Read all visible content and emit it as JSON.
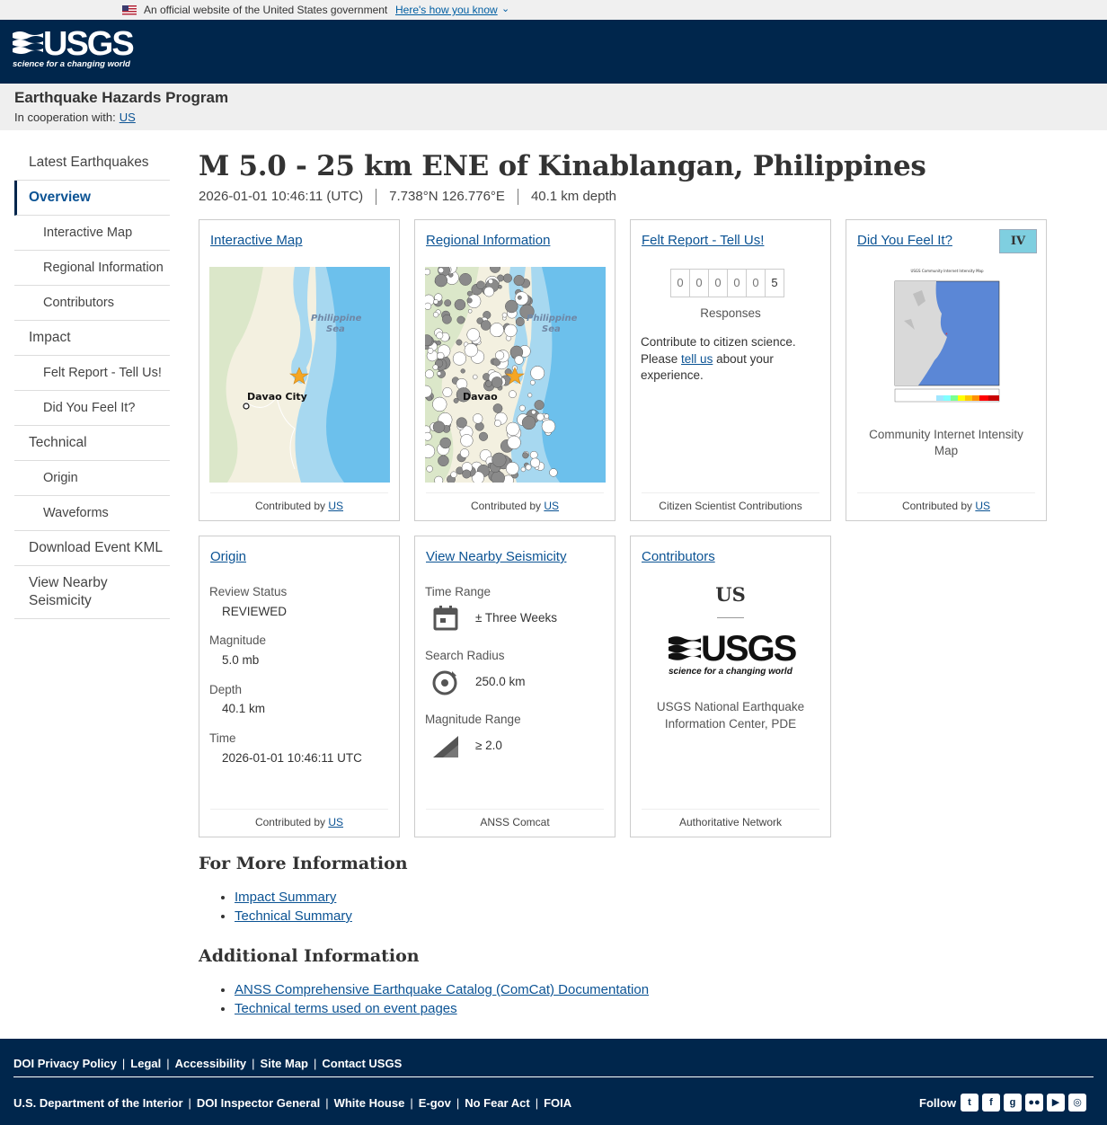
{
  "gov_banner": {
    "text": "An official website of the United States government",
    "how_link": "Here's how you know"
  },
  "header": {
    "logo_word": "USGS",
    "logo_tagline": "science for a changing world"
  },
  "program": {
    "title": "Earthquake Hazards Program",
    "coop_label": "In cooperation with:",
    "coop_link": "US"
  },
  "sidebar": {
    "items": [
      {
        "label": "Latest Earthquakes"
      },
      {
        "label": "Overview"
      },
      {
        "label": "Interactive Map"
      },
      {
        "label": "Regional Information"
      },
      {
        "label": "Contributors"
      },
      {
        "label": "Impact"
      },
      {
        "label": "Felt Report - Tell Us!"
      },
      {
        "label": "Did You Feel It?"
      },
      {
        "label": "Technical"
      },
      {
        "label": "Origin"
      },
      {
        "label": "Waveforms"
      },
      {
        "label": "Download Event KML"
      },
      {
        "label": "View Nearby Seismicity"
      }
    ]
  },
  "event": {
    "title": "M 5.0 - 25 km ENE of Kinablangan, Philippines",
    "time": "2026-01-01 10:46:11 (UTC)",
    "coords": "7.738°N 126.776°E",
    "depth": "40.1 km depth"
  },
  "cards": {
    "interactive_map": {
      "title": "Interactive Map",
      "sea_label_1": "Philippine",
      "sea_label_2": "Sea",
      "city_label": "Davao City",
      "footer_prefix": "Contributed by",
      "footer_link": "US"
    },
    "regional": {
      "title": "Regional Information",
      "sea_label_1": "Philippine",
      "sea_label_2": "Sea",
      "city_label": "Davao",
      "footer_prefix": "Contributed by",
      "footer_link": "US"
    },
    "felt_report": {
      "title": "Felt Report - Tell Us!",
      "digits": [
        "0",
        "0",
        "0",
        "0",
        "0",
        "5"
      ],
      "responses_label": "Responses",
      "text_before": "Contribute to citizen science. Please",
      "tell_us_link": "tell us",
      "text_after": "about your experience.",
      "footer": "Citizen Scientist Contributions"
    },
    "dyfi": {
      "title": "Did You Feel It?",
      "mmi": "IV",
      "caption": "Community Internet Intensity Map",
      "map_title": "USGS Community Internet Intensity Map",
      "footer_prefix": "Contributed by",
      "footer_link": "US"
    },
    "origin": {
      "title": "Origin",
      "fields": [
        {
          "label": "Review Status",
          "value": "REVIEWED"
        },
        {
          "label": "Magnitude",
          "value": "5.0 mb"
        },
        {
          "label": "Depth",
          "value": "40.1 km"
        },
        {
          "label": "Time",
          "value": "2026-01-01 10:46:11 UTC"
        }
      ],
      "footer_prefix": "Contributed by",
      "footer_link": "US"
    },
    "nearby": {
      "title": "View Nearby Seismicity",
      "time_range_label": "Time Range",
      "time_range_value": "± Three Weeks",
      "radius_label": "Search Radius",
      "radius_value": "250.0 km",
      "mag_label": "Magnitude Range",
      "mag_value": "≥ 2.0",
      "footer": "ANSS Comcat"
    },
    "contributors": {
      "title": "Contributors",
      "code": "US",
      "logo_word": "USGS",
      "logo_tagline": "science for a changing world",
      "name": "USGS National Earthquake Information Center, PDE",
      "footer": "Authoritative Network"
    }
  },
  "more_info": {
    "heading": "For More Information",
    "links": [
      "Impact Summary",
      "Technical Summary"
    ]
  },
  "additional_info": {
    "heading": "Additional Information",
    "links": [
      "ANSS Comprehensive Earthquake Catalog (ComCat) Documentation",
      "Technical terms used on event pages"
    ]
  },
  "footer": {
    "row1": [
      "DOI Privacy Policy",
      "Legal",
      "Accessibility",
      "Site Map",
      "Contact USGS"
    ],
    "row2": [
      "U.S. Department of the Interior",
      "DOI Inspector General",
      "White House",
      "E-gov",
      "No Fear Act",
      "FOIA"
    ],
    "follow": "Follow",
    "social_icons": [
      "twitter-icon",
      "facebook-icon",
      "github-icon",
      "flickr-icon",
      "youtube-icon",
      "instagram-icon"
    ]
  },
  "colors": {
    "header_bg": "#00264c",
    "link": "#0b5394",
    "mmi_iv": "#7fcfe0",
    "star": "#f5a623"
  }
}
